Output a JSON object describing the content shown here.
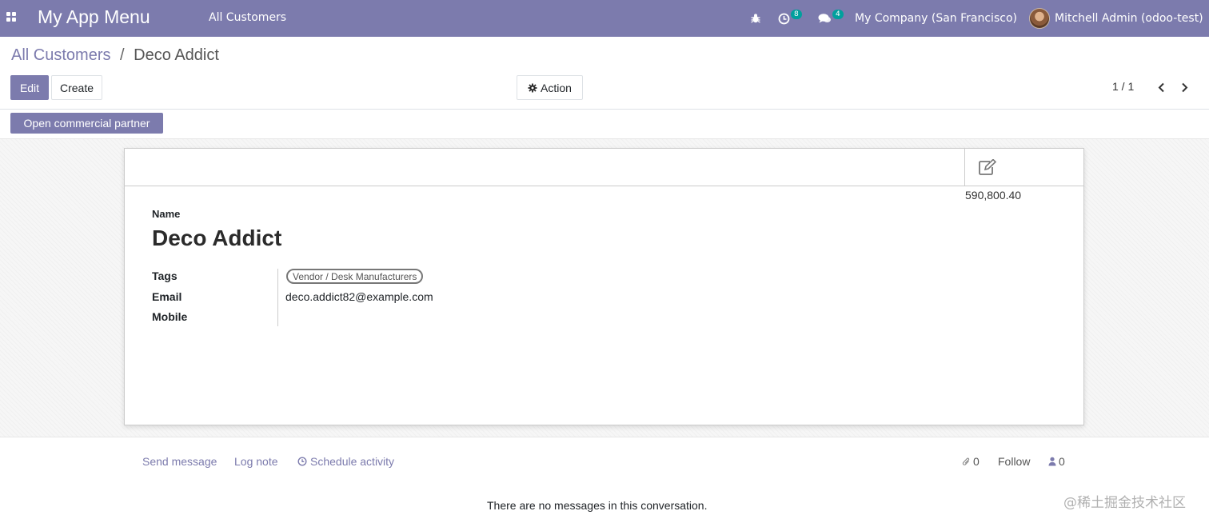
{
  "navbar": {
    "app_title": "My App Menu",
    "menu_item": "All Customers",
    "activity_badge": "8",
    "messages_badge": "4",
    "company": "My Company (San Francisco)",
    "user": "Mitchell Admin (odoo-test)"
  },
  "breadcrumb": {
    "parent": "All Customers",
    "separator": "/",
    "current": "Deco Addict"
  },
  "toolbar": {
    "edit_label": "Edit",
    "create_label": "Create",
    "action_label": "Action"
  },
  "pager": {
    "value": "1 / 1"
  },
  "statusbar": {
    "open_partner_label": "Open commercial partner"
  },
  "form": {
    "stat_value": "590,800.40",
    "name_label": "Name",
    "name_value": "Deco Addict",
    "tags_label": "Tags",
    "tag_value": "Vendor / Desk Manufacturers",
    "email_label": "Email",
    "email_value": "deco.addict82@example.com",
    "mobile_label": "Mobile"
  },
  "chatter": {
    "send_message": "Send message",
    "log_note": "Log note",
    "schedule_activity": "Schedule activity",
    "attachments_count": "0",
    "follow_label": "Follow",
    "followers_count": "0",
    "empty_text": "There are no messages in this conversation."
  },
  "watermark": "@稀土掘金技术社区",
  "colors": {
    "brand": "#7c7bad",
    "badge": "#00a09d"
  }
}
